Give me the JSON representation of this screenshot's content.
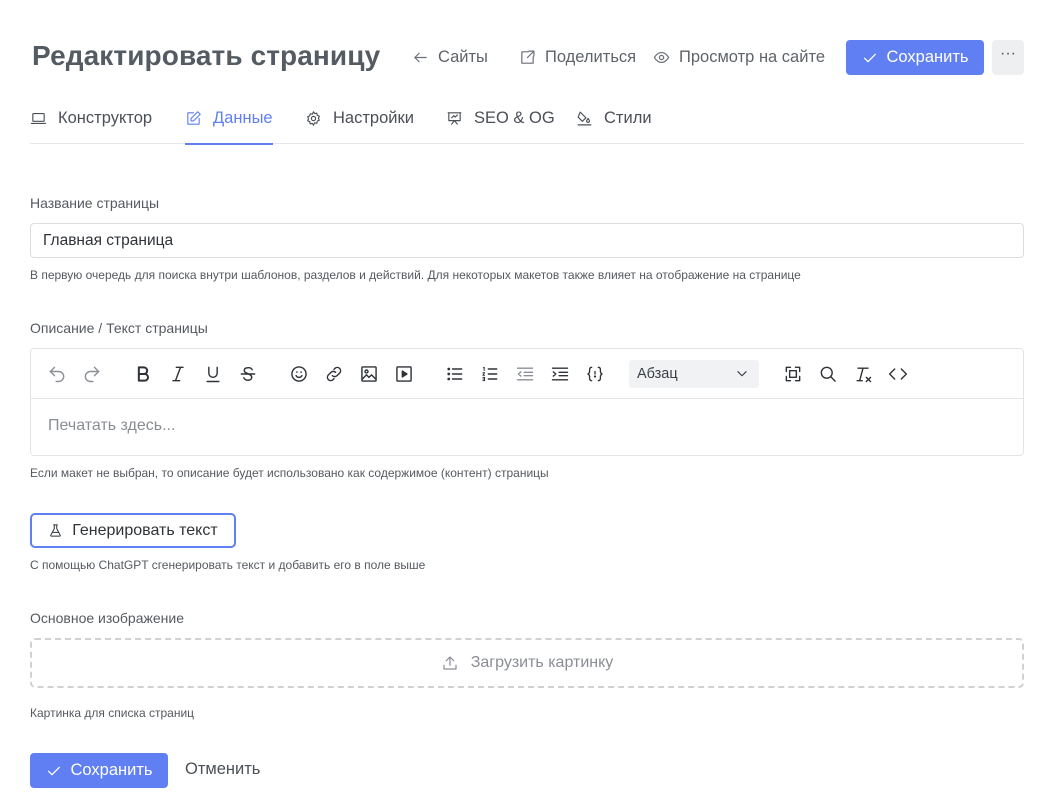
{
  "header": {
    "title": "Редактировать страницу",
    "sites_label": "Сайты",
    "share_label": "Поделиться",
    "view_label": "Просмотр на сайте",
    "save_label": "Сохранить",
    "more_label": "···"
  },
  "tabs": [
    {
      "label": "Конструктор",
      "icon": "laptop-icon",
      "active": false
    },
    {
      "label": "Данные",
      "icon": "edit-icon",
      "active": true
    },
    {
      "label": "Настройки",
      "icon": "gear-icon",
      "active": false
    },
    {
      "label": "SEO & OG",
      "icon": "presentation-chart-icon",
      "active": false
    },
    {
      "label": "Стили",
      "icon": "paint-bucket-icon",
      "active": false
    }
  ],
  "form": {
    "name_label": "Название страницы",
    "name_value": "Главная страница",
    "name_hint": "В первую очередь для поиска внутри шаблонов, разделов и действий. Для некоторых макетов также влияет на отображение на странице",
    "desc_label": "Описание / Текст страницы",
    "desc_placeholder": "Печатать здесь...",
    "desc_hint": "Если макет не выбран, то описание будет использовано как содержимое (контент) страницы",
    "block_format": "Абзац",
    "generate_label": "Генерировать текст",
    "generate_hint": "С помощью ChatGPT сгенерировать текст и добавить его в поле выше",
    "image_label": "Основное изображение",
    "upload_label": "Загрузить картинку",
    "image_hint": "Картинка для списка страниц"
  },
  "footer": {
    "save_label": "Сохранить",
    "cancel_label": "Отменить"
  },
  "colors": {
    "accent": "#5f7ff3",
    "text": "#2f3338",
    "muted": "#8a8e94"
  }
}
